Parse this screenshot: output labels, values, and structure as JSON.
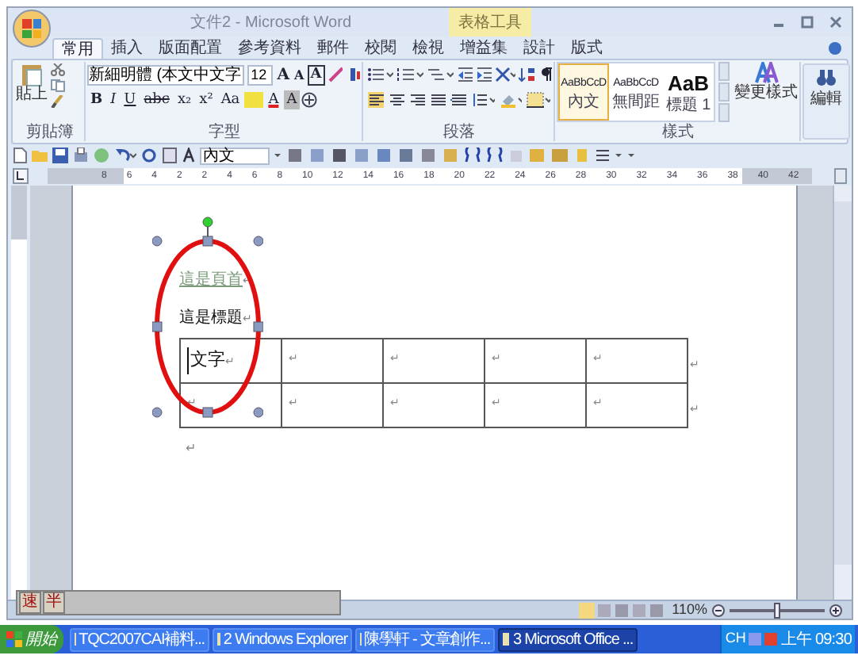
{
  "window": {
    "title": "文件2 - Microsoft Word",
    "context_group": "表格工具"
  },
  "tabs": [
    {
      "label": "常用",
      "selected": true
    },
    {
      "label": "插入",
      "selected": false
    },
    {
      "label": "版面配置",
      "selected": false
    },
    {
      "label": "參考資料",
      "selected": false
    },
    {
      "label": "郵件",
      "selected": false
    },
    {
      "label": "校閱",
      "selected": false
    },
    {
      "label": "檢視",
      "selected": false
    },
    {
      "label": "增益集",
      "selected": false
    },
    {
      "label": "設計",
      "selected": false
    },
    {
      "label": "版式",
      "selected": false
    }
  ],
  "ribbon": {
    "clipboard": {
      "label": "剪貼簿",
      "paste": "貼上"
    },
    "font": {
      "label": "字型",
      "font_name": "新細明體 (本文中文字",
      "font_size": "12",
      "row1_buttons": [
        {
          "kind": "grow",
          "label": "A"
        },
        {
          "kind": "shrink",
          "label": "A"
        },
        {
          "kind": "border",
          "label": "A"
        }
      ],
      "format_buttons": [
        {
          "kind": "bold",
          "label": "B"
        },
        {
          "kind": "italic",
          "label": "I"
        },
        {
          "kind": "underline",
          "label": "U"
        },
        {
          "kind": "strike",
          "label": "abc"
        },
        {
          "kind": "sub",
          "label": "x₂"
        },
        {
          "kind": "sup",
          "label": "x²"
        },
        {
          "kind": "case",
          "label": "Aa"
        },
        {
          "kind": "color",
          "label": "A"
        },
        {
          "kind": "shade",
          "label": "A"
        }
      ]
    },
    "paragraph": {
      "label": "段落"
    },
    "styles": {
      "label": "樣式",
      "gallery": [
        {
          "preview": "AaBbCcD",
          "name": "內文",
          "selected": true
        },
        {
          "preview": "AaBbCcD",
          "name": "無間距",
          "selected": false
        },
        {
          "preview": "AaB",
          "name": "標題 1",
          "selected": false
        }
      ],
      "change_styles": "變更樣式"
    },
    "editing": {
      "label": "編輯"
    }
  },
  "quick_toolbar": {
    "style_box": "內文"
  },
  "ruler": {
    "labels": [
      "8",
      "6",
      "4",
      "2",
      "2",
      "4",
      "6",
      "8",
      "10",
      "12",
      "14",
      "16",
      "18",
      "20",
      "22",
      "24",
      "26",
      "28",
      "30",
      "32",
      "34",
      "36",
      "38",
      "40",
      "42"
    ]
  },
  "document": {
    "paragraphs": [
      {
        "kind": "header",
        "text": "這是頁首",
        "mark": "↵"
      },
      {
        "kind": "heading",
        "text": "這是標題",
        "mark": "↵"
      }
    ],
    "table": {
      "rows": [
        {
          "cells": [
            {
              "text": "文字",
              "mark": "↵"
            },
            {
              "mark": "↵"
            },
            {
              "mark": "↵"
            },
            {
              "mark": "↵"
            },
            {
              "mark": "↵"
            }
          ],
          "end_mark": "↵"
        },
        {
          "cells": [
            {
              "mark": "↵"
            },
            {
              "mark": "↵"
            },
            {
              "mark": "↵"
            },
            {
              "mark": "↵"
            },
            {
              "mark": "↵"
            }
          ],
          "end_mark": "↵"
        }
      ]
    },
    "after_mark": "↵",
    "shape": {
      "kind": "ellipse",
      "selected": true
    }
  },
  "status_bar": {
    "zoom": "110%",
    "zoom_slider": {
      "level": 0.5
    }
  },
  "ime_bar": [
    "速",
    "半"
  ],
  "taskbar": {
    "start": "開始",
    "buttons": [
      {
        "label": "TQC2007CAI補料...",
        "selected": false
      },
      {
        "label": "2 Windows Explorer",
        "selected": false
      },
      {
        "label": "陳學軒 - 文章創作...",
        "selected": false
      },
      {
        "label": "3 Microsoft Office ...",
        "selected": true
      }
    ],
    "language": "CH",
    "clock": "上午 09:30"
  }
}
